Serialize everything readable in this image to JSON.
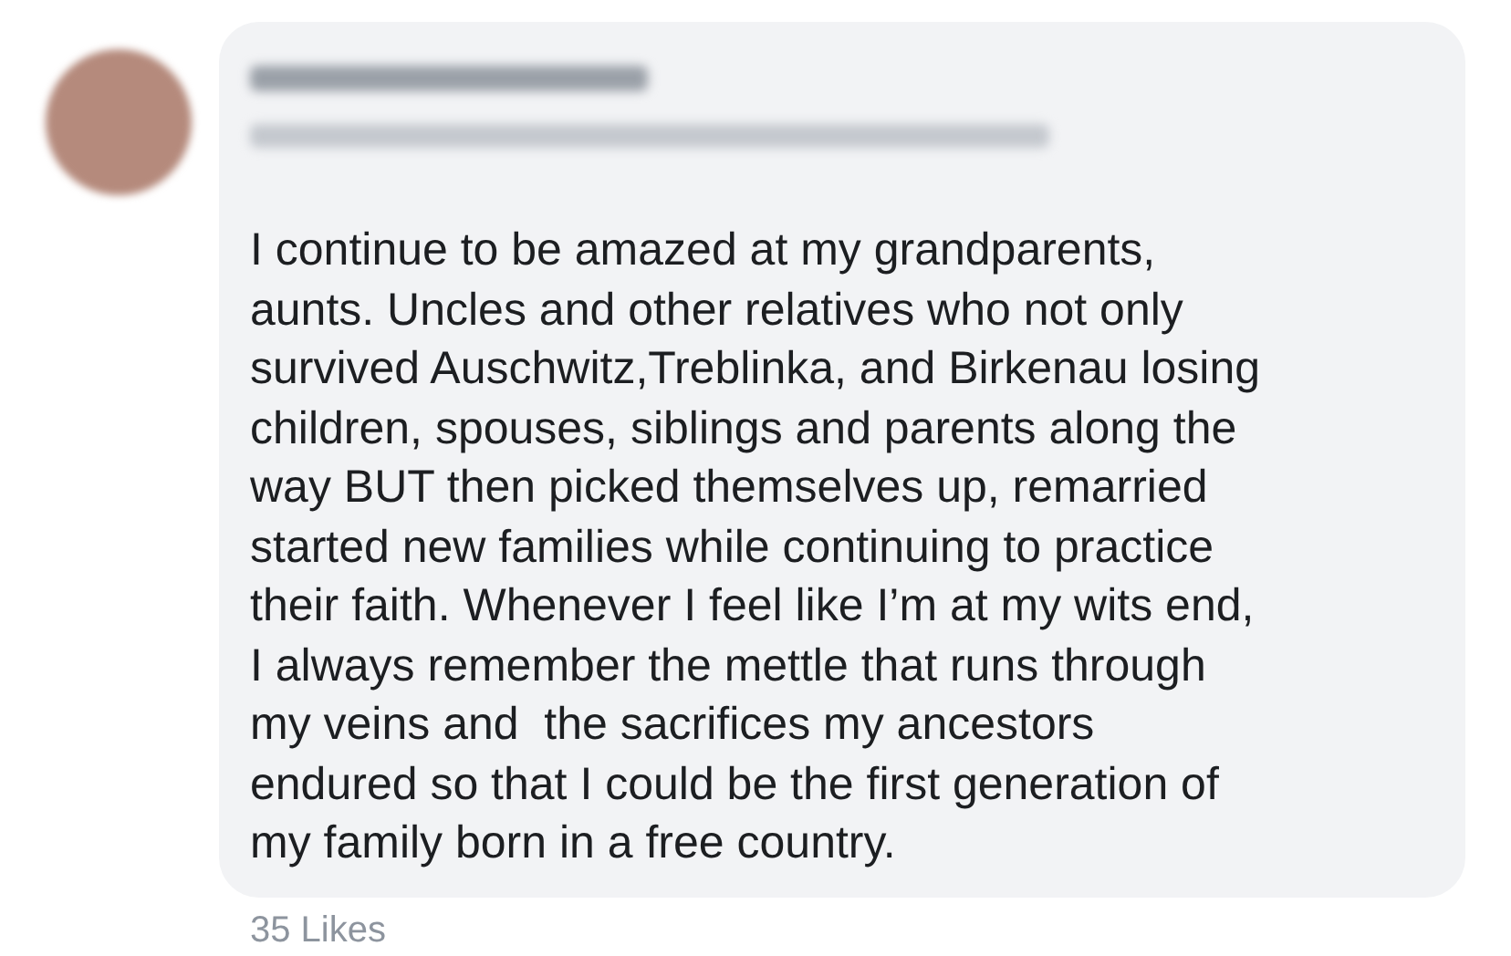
{
  "comment": {
    "text": "I continue to be amazed at my grandparents,\naunts. Uncles and other relatives who not only\nsurvived Auschwitz,Treblinka, and Birkenau losing\nchildren, spouses, siblings and parents along the\nway BUT then picked themselves up, remarried\nstarted new families while continuing to practice\ntheir faith. Whenever I feel like I’m at my wits end,\nI always remember the mettle that runs through\nmy veins and  the sacrifices my ancestors\nendured so that I could be the first generation of\nmy family born in a free country."
  },
  "likes": "35 Likes"
}
